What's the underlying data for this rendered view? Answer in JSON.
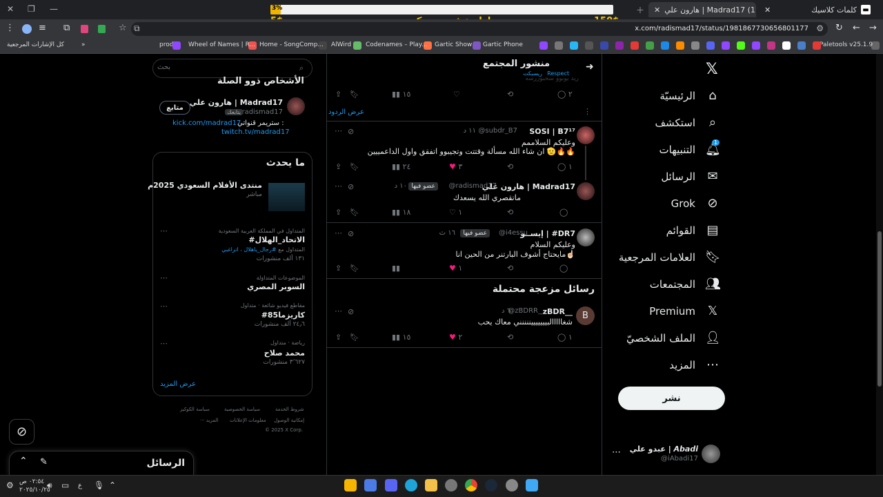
{
  "browser": {
    "tabs": [
      {
        "label": "كلمات كلاسيك"
      },
      {
        "label": "هارون علي | Madrad17 (1)"
      },
      {
        "label": ""
      }
    ],
    "url": "x.com/radismad17/status/1981867730656801177",
    "bookmarks": [
      "Paletools v25.1.9",
      "Gartic Phone",
      "Gartic Show",
      "Codenames – Play...",
      "AlWird",
      "Home - SongComp...",
      "Wheel of Names | R...",
      "prod",
      "كل الإشارات المرجعية"
    ]
  },
  "stream_overlay": {
    "progress_label": "3%",
    "progress": 0.03,
    "goal_amount": "150$",
    "priority_text": "اولوية في ريسبكت",
    "priority_amount": "5$"
  },
  "left_nav": {
    "items": [
      {
        "label": "الرئيسيّة",
        "icon": "home-icon"
      },
      {
        "label": "استكشف",
        "icon": "search-icon"
      },
      {
        "label": "التنبيهات",
        "icon": "bell-icon",
        "badge": "1"
      },
      {
        "label": "الرسائل",
        "icon": "mail-icon"
      },
      {
        "label": "Grok",
        "icon": "grok-icon"
      },
      {
        "label": "القوائم",
        "icon": "list-icon"
      },
      {
        "label": "العلامات المرجعية",
        "icon": "bookmark-icon"
      },
      {
        "label": "المجتمعات",
        "icon": "communities-icon"
      },
      {
        "label": "Premium",
        "icon": "x-logo-icon"
      },
      {
        "label": "الملف الشخصيّ",
        "icon": "profile-icon"
      },
      {
        "label": "المزيد",
        "icon": "more-icon"
      }
    ],
    "post_button": "نشر",
    "account": {
      "name": "عبدو علي | 𝘼𝙗𝙖𝙙𝙞",
      "handle": "@iAbadi17"
    }
  },
  "timeline": {
    "header": {
      "title": "منشور المجتمع",
      "subtitle_community": "Respect",
      "subtitle_name": "ريسبكت"
    },
    "top_tweet": {
      "cut_text": "رید يوبوو سحبوزرسه",
      "replies": "٢",
      "views": "١٥"
    },
    "show_replies": "عرض الردود",
    "tweets": [
      {
        "name": "SOSI | B7¹⁷",
        "handle": "@subdr_B7",
        "time": "١١ د",
        "member_badge": "",
        "text": "وعليكم السلاممم",
        "text2": "ان شاء الله مسألة وقتتت وتجيبوو اتفقق واول الداعمييين 🫡🔥🔥",
        "replies": "١",
        "likes": "٣",
        "views": "٢٤"
      },
      {
        "name": "هارون علي | Madrad17",
        "handle": "@radismad17",
        "time": "١٠ د",
        "member_badge": "عضو فيها",
        "text": "ماتقصري الله يسعدك",
        "text2": "",
        "replies": "",
        "likes": "١",
        "views": "١٨"
      },
      {
        "name": "إيســو | #DR7",
        "handle": "@i4essu",
        "time": "١٦ ث",
        "member_badge": "عضو فيها",
        "text": "وعليكم السلام",
        "text2": "مايحتاج أشوف البارتنر من الحين انا☝🏻",
        "replies": "",
        "likes": "١",
        "views": ""
      }
    ],
    "section_title": "رسائل مزعجة محتملة",
    "spam_tweet": {
      "avatar_letter": "B",
      "name": "zBDR__",
      "handle": "@zBDRR__",
      "time": "٦ د",
      "text": "شغااااالبيييييييننننني معاك يحب",
      "replies": "١",
      "likes": "٢",
      "views": "١٥"
    }
  },
  "right_column": {
    "search_placeholder": "بحث",
    "relevant_people": {
      "title": "الأشخاص ذوو الصلة",
      "name": "هارون علي | Madrad17",
      "handle": "@radismad17",
      "follows_you": "يتابعك",
      "follow_button": "متابع",
      "bio_prefix": "ستريمر قنواتي :",
      "link1": "kick.com/madrad17",
      "link2": "twitch.tv/madrad17"
    },
    "trending": {
      "title": "ما يحدث",
      "featured": {
        "title": "منتدى الأفلام السعودي 2025م",
        "meta": "مباشر"
      },
      "items": [
        {
          "context": "المتداول في المملكة العربية السعودية",
          "name": "#الاتحاد_الهلال",
          "extra_prefix": "المتداول مع",
          "extra_tag1": "#رجال_ياهلال",
          "extra_tag2": "اتراغبي",
          "count": "١٣١ ألف منشورات"
        },
        {
          "context": "الموضوعات المتداوَلة",
          "name": "السوبر المصري",
          "count": ""
        },
        {
          "context": "مقاطع فيديو شائعة · متداول",
          "name": "#كاريزما85",
          "count": "٢٤٫٦ ألف منشورات"
        },
        {
          "context": "رياضة · متداول",
          "name": "محمد صلاح",
          "count": "٣٬٦٢٧ منشورات"
        }
      ],
      "show_more": "عرض المزيد"
    },
    "footer": {
      "links": [
        "شروط الخدمة",
        "سياسة الخصوصية",
        "سياسة الكوكيز",
        "إمكانية الوصول",
        "معلومات الإعلانات",
        "··· المزيد"
      ],
      "copyright": "© 2025 X Corp."
    }
  },
  "messages_drawer": {
    "title": "الرسائل"
  },
  "taskbar": {
    "time": "٠٢:٥٤ ص",
    "date": "٢٠٢٥/١٠/٢٥",
    "lang": "ع"
  },
  "colors": {
    "accent": "#1d9bf0",
    "like": "#f91880",
    "overlay_yellow": "#f5c400"
  }
}
